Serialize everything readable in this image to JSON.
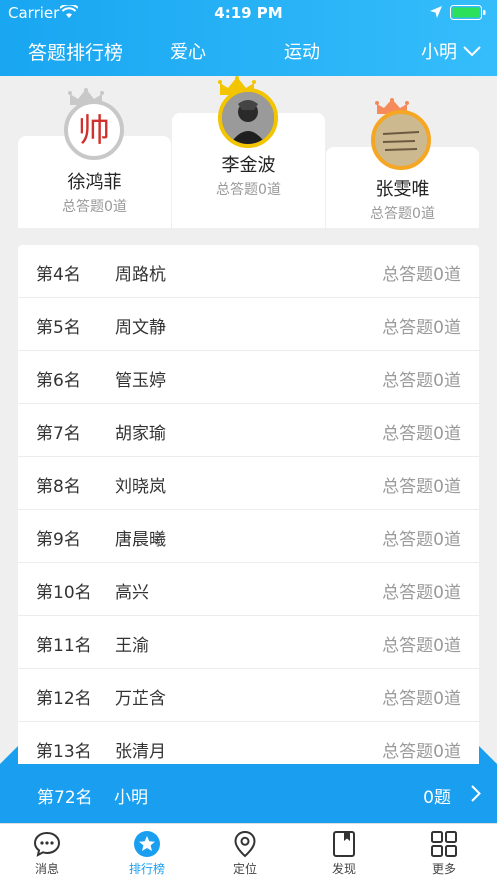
{
  "status_bar": {
    "carrier": "Carrier",
    "time": "4:19 PM"
  },
  "nav": {
    "tabs": [
      {
        "label": "答题排行榜",
        "active": true
      },
      {
        "label": "爱心",
        "active": false
      },
      {
        "label": "运动",
        "active": false
      }
    ],
    "user": "小明"
  },
  "podium": [
    {
      "place": 2,
      "name": "徐鸿菲",
      "count": "总答题0道",
      "avatar_text": "帅",
      "crown_color": "#c8c8c8",
      "ring_color": "#c8c8c8"
    },
    {
      "place": 1,
      "name": "李金波",
      "count": "总答题0道",
      "crown_color": "#f3c400",
      "ring_color": "#f3c400"
    },
    {
      "place": 3,
      "name": "张雯唯",
      "count": "总答题0道",
      "crown_color": "#f58a5a",
      "ring_color": "#f5a623"
    }
  ],
  "ranking": [
    {
      "rank": "第4名",
      "name": "周路杭",
      "count": "总答题0道"
    },
    {
      "rank": "第5名",
      "name": "周文静",
      "count": "总答题0道"
    },
    {
      "rank": "第6名",
      "name": "管玉婷",
      "count": "总答题0道"
    },
    {
      "rank": "第7名",
      "name": "胡家瑜",
      "count": "总答题0道"
    },
    {
      "rank": "第8名",
      "name": "刘晓岚",
      "count": "总答题0道"
    },
    {
      "rank": "第9名",
      "name": "唐晨曦",
      "count": "总答题0道"
    },
    {
      "rank": "第10名",
      "name": "高兴",
      "count": "总答题0道"
    },
    {
      "rank": "第11名",
      "name": "王渝",
      "count": "总答题0道"
    },
    {
      "rank": "第12名",
      "name": "万芷含",
      "count": "总答题0道"
    },
    {
      "rank": "第13名",
      "name": "张清月",
      "count": "总答题0道"
    }
  ],
  "my_rank": {
    "rank": "第72名",
    "name": "小明",
    "count": "0题"
  },
  "tab_bar": [
    {
      "label": "消息",
      "icon": "message-icon",
      "active": false
    },
    {
      "label": "排行榜",
      "icon": "ranking-star-icon",
      "active": true
    },
    {
      "label": "定位",
      "icon": "location-pin-icon",
      "active": false
    },
    {
      "label": "发现",
      "icon": "discover-book-icon",
      "active": false
    },
    {
      "label": "更多",
      "icon": "more-grid-icon",
      "active": false
    }
  ],
  "colors": {
    "accent": "#1a9ff0",
    "header_start": "#19a6f1",
    "header_end": "#35bdfb"
  }
}
